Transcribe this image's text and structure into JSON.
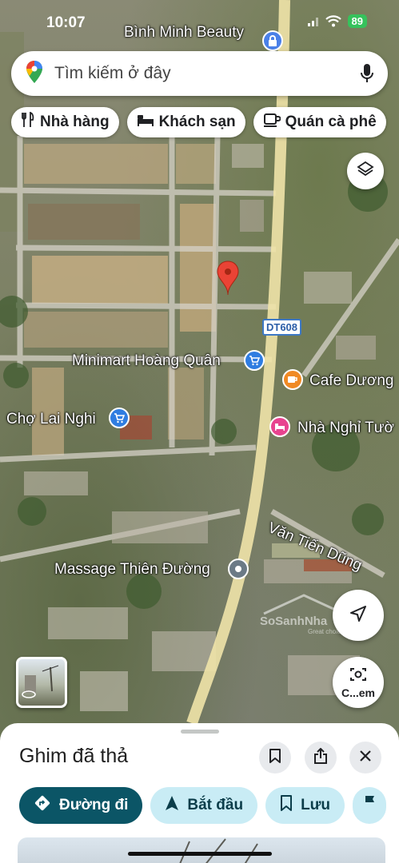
{
  "status_bar": {
    "time": "10:07",
    "battery": "89"
  },
  "search": {
    "placeholder": "Tìm kiếm ở đây"
  },
  "chips": [
    {
      "label": "Nhà hàng",
      "icon": "fork-knife-icon"
    },
    {
      "label": "Khách sạn",
      "icon": "bed-icon"
    },
    {
      "label": "Quán cà phê",
      "icon": "coffee-cup-icon"
    }
  ],
  "map": {
    "road_badge": "DT608",
    "labels": {
      "binh_minh": "Bình Minh Beauty",
      "minimart": "Minimart Hoàng Quân",
      "cafe": "Cafe Dương",
      "cho": "Chợ Lai Nghi",
      "nha_nghi": "Nhà Nghỉ Tườ",
      "street": "Văn Tiến Dũng",
      "massage": "Massage Thiên Đường"
    },
    "watermark": "SoSanhNha",
    "watermark_sub": "Great choice for you"
  },
  "camera_button": {
    "label": "C...em"
  },
  "sheet": {
    "title": "Ghim đã thả",
    "actions": [
      {
        "label": "Đường đi",
        "icon": "directions-icon"
      },
      {
        "label": "Bắt đầu",
        "icon": "navigation-arrow-icon"
      },
      {
        "label": "Lưu",
        "icon": "bookmark-icon"
      }
    ]
  },
  "colors": {
    "primary": "#0b5566",
    "secondary": "#c9ecf5",
    "pin": "#ea4335"
  }
}
